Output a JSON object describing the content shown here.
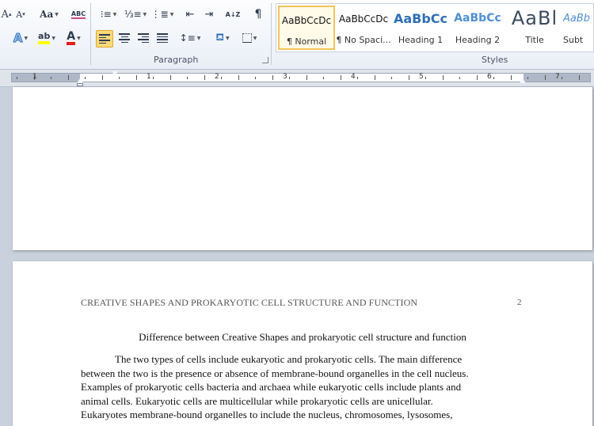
{
  "ribbon": {
    "paragraph_label": "Paragraph",
    "styles_label": "Styles",
    "font_tools": {
      "grow_font": "A",
      "shrink_font": "A",
      "change_case": "Aa",
      "clear_format": "ABC",
      "text_effects": "A",
      "highlight": "ab",
      "font_color": "A"
    },
    "pilcrow": "¶",
    "sort": "A↓Z",
    "styles": [
      {
        "sample": "AaBbCcDc",
        "name": "¶ Normal",
        "selected": true
      },
      {
        "sample": "AaBbCcDc",
        "name": "¶ No Spaci...",
        "selected": false
      },
      {
        "sample": "AaBbCc",
        "name": "Heading 1",
        "selected": false
      },
      {
        "sample": "AaBbCc",
        "name": "Heading 2",
        "selected": false
      },
      {
        "sample": "AaBl",
        "name": "Title",
        "selected": false
      },
      {
        "sample": "AaBb",
        "name": "Subt",
        "selected": false
      }
    ],
    "colors": {
      "heading": "#2e6fb5",
      "highlight": "#ffff00",
      "font_color": "#e31b1b",
      "selected_border": "#f2c45a"
    }
  },
  "ruler": {
    "numbers": [
      "1",
      "1",
      "2",
      "3",
      "4",
      "5",
      "6",
      "7"
    ]
  },
  "document": {
    "header_text": "CREATIVE SHAPES AND PROKARYOTIC  CELL STRUCTURE  AND FUNCTION",
    "page_number": "2",
    "title": "Difference between Creative Shapes and prokaryotic cell structure and function",
    "body_lines": [
      "The two types of cells include eukaryotic and prokaryotic cells. The main difference",
      "between the two is the presence or absence of membrane-bound organelles in the cell nucleus.",
      "Examples of prokaryotic cells bacteria and archaea while eukaryotic cells include plants and",
      "animal cells.  Eukaryotic cells are multicellular while prokaryotic cells are unicellular.",
      "Eukaryotes membrane-bound organelles to include the nucleus, chromosomes, lysosomes,"
    ]
  }
}
